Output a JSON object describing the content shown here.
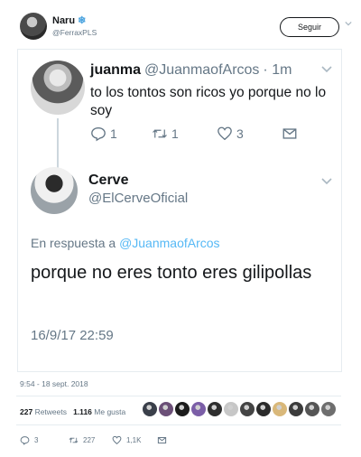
{
  "outer": {
    "display_name": "Naru",
    "badge_icon": "snowflake-icon",
    "handle": "@FerraxPLS",
    "follow_label": "Seguir",
    "timestamp": "9:54 - 18 sept. 2018",
    "stats": {
      "retweets_count": "227",
      "retweets_label": "Retweets",
      "likes_count": "1.116",
      "likes_label": "Me gusta"
    },
    "likers_colors": [
      "#3a3f4a",
      "#6b4f77",
      "#1c1c1c",
      "#7b5ea7",
      "#2e2e2e",
      "#c7c7c7",
      "#444444",
      "#2b2b2b",
      "#d9b87a",
      "#3b3b3b",
      "#555555",
      "#6e6e6e"
    ],
    "actions": {
      "replies": "3",
      "retweets": "227",
      "likes": "1,1K"
    }
  },
  "embedded": {
    "tweet1": {
      "name": "juanma",
      "handle": "@JuanmaofArcos",
      "time": "· 1m",
      "text": "to los tontos son ricos yo porque no lo soy",
      "replies": "1",
      "retweets": "1",
      "likes": "3"
    },
    "tweet2": {
      "name": "Cerve",
      "handle": "@ElCerveOficial",
      "reply_prefix": "En respuesta a",
      "reply_handle": "@JuanmaofArcos",
      "text": "porque no eres tonto eres gilipollas",
      "date": "16/9/17 22:59"
    }
  },
  "colors": {
    "text_primary": "#14171a",
    "text_secondary": "#657786",
    "accent": "#1da1f2",
    "border": "#e6ecf0"
  }
}
